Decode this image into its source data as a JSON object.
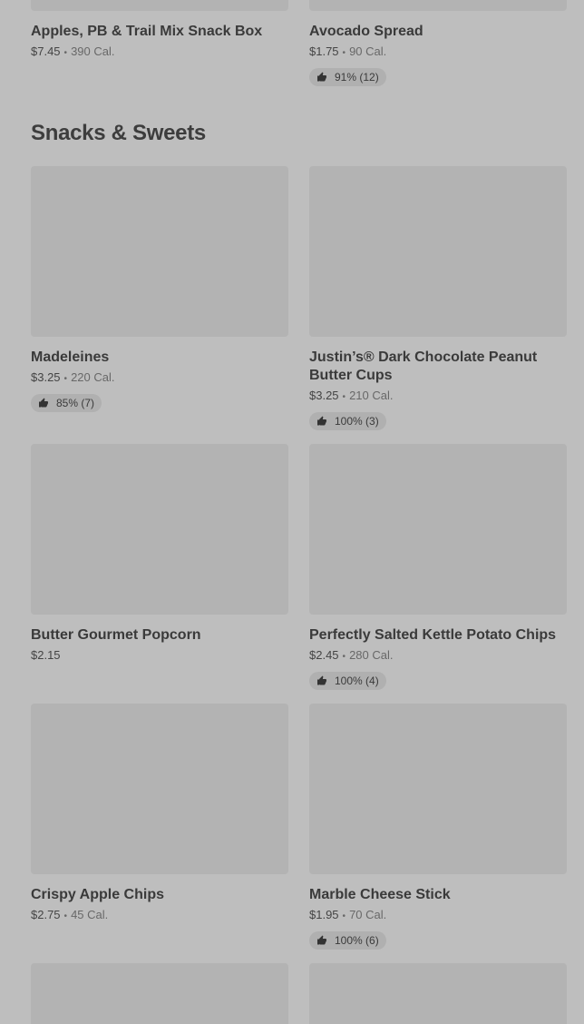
{
  "top_items": [
    {
      "name": "Apples, PB & Trail Mix Snack Box",
      "price": "$7.45",
      "calories": "390 Cal.",
      "rating": ""
    },
    {
      "name": "Avocado Spread",
      "price": "$1.75",
      "calories": "90 Cal.",
      "rating": "91% (12)"
    }
  ],
  "section": {
    "title": "Snacks & Sweets",
    "items": [
      {
        "name": "Madeleines",
        "price": "$3.25",
        "calories": "220 Cal.",
        "rating": "85% (7)"
      },
      {
        "name": "Justin’s® Dark Chocolate Peanut Butter Cups",
        "price": "$3.25",
        "calories": "210 Cal.",
        "rating": "100% (3)"
      },
      {
        "name": "Butter Gourmet Popcorn",
        "price": "$2.15",
        "calories": "",
        "rating": ""
      },
      {
        "name": "Perfectly Salted Kettle Potato Chips",
        "price": "$2.45",
        "calories": "280 Cal.",
        "rating": "100% (4)"
      },
      {
        "name": "Crispy Apple Chips",
        "price": "$2.75",
        "calories": "45 Cal.",
        "rating": ""
      },
      {
        "name": "Marble Cheese Stick",
        "price": "$1.95",
        "calories": "70 Cal.",
        "rating": "100% (6)"
      }
    ]
  },
  "separator": "•",
  "icons": {
    "rating": "thumbs-up-icon"
  },
  "colors": {
    "background": "#bebebe",
    "image_placeholder": "#b3b3b3",
    "rating_pill": "#b0b0b0"
  }
}
